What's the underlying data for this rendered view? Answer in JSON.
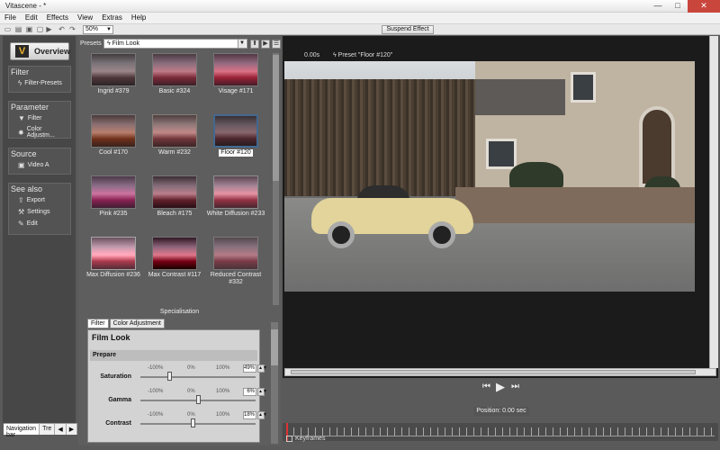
{
  "window": {
    "title": "Vitascene - *",
    "minimize": "—",
    "maximize": "□",
    "close": "✕"
  },
  "menu": [
    "File",
    "Edit",
    "Effects",
    "View",
    "Extras",
    "Help"
  ],
  "toolbar": {
    "zoom": "50%",
    "suspend": "Suspend Effect"
  },
  "nav": {
    "overview": "Overview",
    "sections": [
      {
        "title": "Filter",
        "items": [
          {
            "label": "Filter-Presets",
            "icon": "lightning-icon"
          }
        ]
      },
      {
        "title": "Parameter",
        "items": [
          {
            "label": "Filter",
            "icon": "filter-icon"
          },
          {
            "label": "Color Adjustm...",
            "icon": "color-icon"
          }
        ]
      },
      {
        "title": "Source",
        "items": [
          {
            "label": "Video A",
            "icon": "video-icon"
          }
        ]
      },
      {
        "title": "See also",
        "items": [
          {
            "label": "Export",
            "icon": "export-icon"
          },
          {
            "label": "Settings",
            "icon": "settings-icon"
          },
          {
            "label": "Edit",
            "icon": "edit-icon"
          }
        ]
      }
    ],
    "tabs": [
      "Navigation bar",
      "Tre"
    ]
  },
  "presets": {
    "label": "Presets",
    "selected": "Film Look",
    "items": [
      "Ingrid #379",
      "Basic #324",
      "Visage #171",
      "Cool #170",
      "Warm #232",
      "Floor #120",
      "Pink #235",
      "Bleach #175",
      "White Diffusion #233",
      "Max Diffusion #236",
      "Max Contrast #117",
      "Reduced Contrast #332"
    ],
    "selected_item": "Floor #120",
    "specialisation": "Specialisation"
  },
  "filter": {
    "tabs": [
      "Filter",
      "Color Adjustment"
    ],
    "title": "Film Look",
    "section": "Prepare",
    "scale": [
      "-100%",
      "0%",
      "100%"
    ],
    "params": [
      {
        "name": "Saturation",
        "value": "49%",
        "level": 0.25
      },
      {
        "name": "Gamma",
        "value": "6%",
        "level": 0.5
      },
      {
        "name": "Contrast",
        "value": "18%",
        "level": 0.45
      }
    ]
  },
  "preview": {
    "time": "0.00s",
    "preset": "Preset \"Floor #120\""
  },
  "transport": {
    "position": "Position: 0.00 sec",
    "keyframes": "Keyframes"
  }
}
